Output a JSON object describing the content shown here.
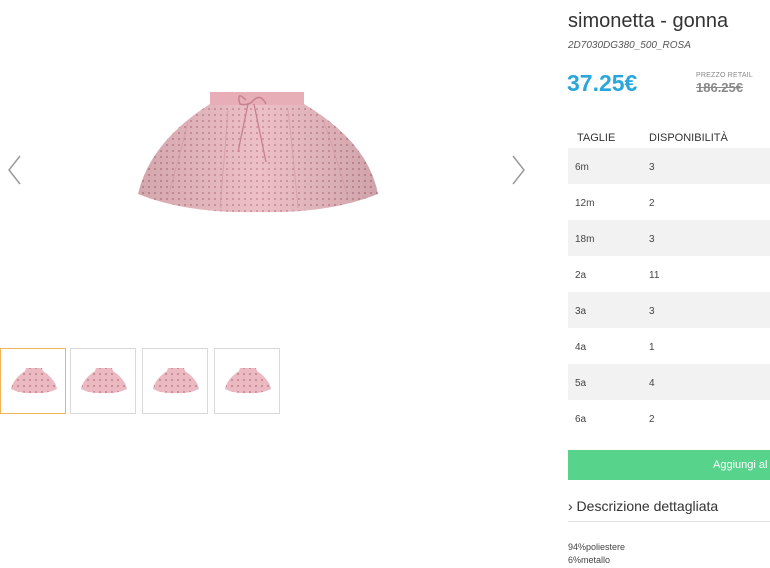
{
  "product": {
    "title": "simonetta - gonna",
    "sku": "2D7030DG380_500_ROSA",
    "price": "37.25€",
    "retail_label": "PREZZO RETAIL",
    "retail_price": "186.25€"
  },
  "availability": {
    "headers": {
      "size": "TAGLIE",
      "stock": "DISPONIBILITÀ"
    },
    "rows": [
      {
        "size": "6m",
        "stock": "3"
      },
      {
        "size": "12m",
        "stock": "2"
      },
      {
        "size": "18m",
        "stock": "3"
      },
      {
        "size": "2a",
        "stock": "11"
      },
      {
        "size": "3a",
        "stock": "3"
      },
      {
        "size": "4a",
        "stock": "1"
      },
      {
        "size": "5a",
        "stock": "4"
      },
      {
        "size": "6a",
        "stock": "2"
      }
    ]
  },
  "actions": {
    "add_label": "Aggiungi al"
  },
  "description": {
    "toggle_label": "› Descrizione dettagliata",
    "lines": [
      "94%poliestere",
      "6%metallo"
    ]
  },
  "gallery": {
    "prev_icon": "chevron-left-icon",
    "next_icon": "chevron-right-icon",
    "thumbnail_count": 4,
    "active_thumbnail": 1
  },
  "colors": {
    "price": "#29a6dc",
    "button": "#58d38b",
    "active_thumb_border": "#f0b355",
    "skirt": "#e9b5be"
  }
}
